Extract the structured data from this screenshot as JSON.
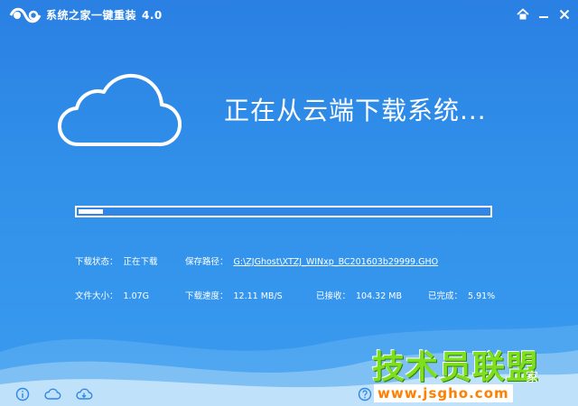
{
  "app": {
    "title": "系统之家一键重装",
    "version": "4.0"
  },
  "titlebar_icons": [
    "logo-icon",
    "home-icon",
    "minimize-icon",
    "close-icon"
  ],
  "status": {
    "headline": "正在从云端下载系统..."
  },
  "progress": {
    "percent": 5.91
  },
  "info": {
    "download_state_label": "下载状态：",
    "download_state_value": "正在下载",
    "save_path_label": "保存路径：",
    "save_path_value": "G:\\ZJGhost\\XTZJ_WINxp_BC201603b29999.GHO",
    "file_size_label": "文件大小：",
    "file_size_value": "1.07G",
    "speed_label": "下载速度：",
    "speed_value": "12.11 MB/S",
    "received_label": "已接收：",
    "received_value": "104.32 MB",
    "completed_label": "已完成：",
    "completed_value": "5.91%"
  },
  "bottom_icons": [
    "info-icon",
    "cloud-icon",
    "cloud-download-icon",
    "help-icon"
  ],
  "watermark": {
    "big": "技术员联盟",
    "url": "www.jsgho.com",
    "tail": "家"
  },
  "colors": {
    "background": "#2f86e4",
    "foreground": "#ffffff",
    "watermark_green": "#7de01d",
    "watermark_orange": "#ff7f00"
  }
}
